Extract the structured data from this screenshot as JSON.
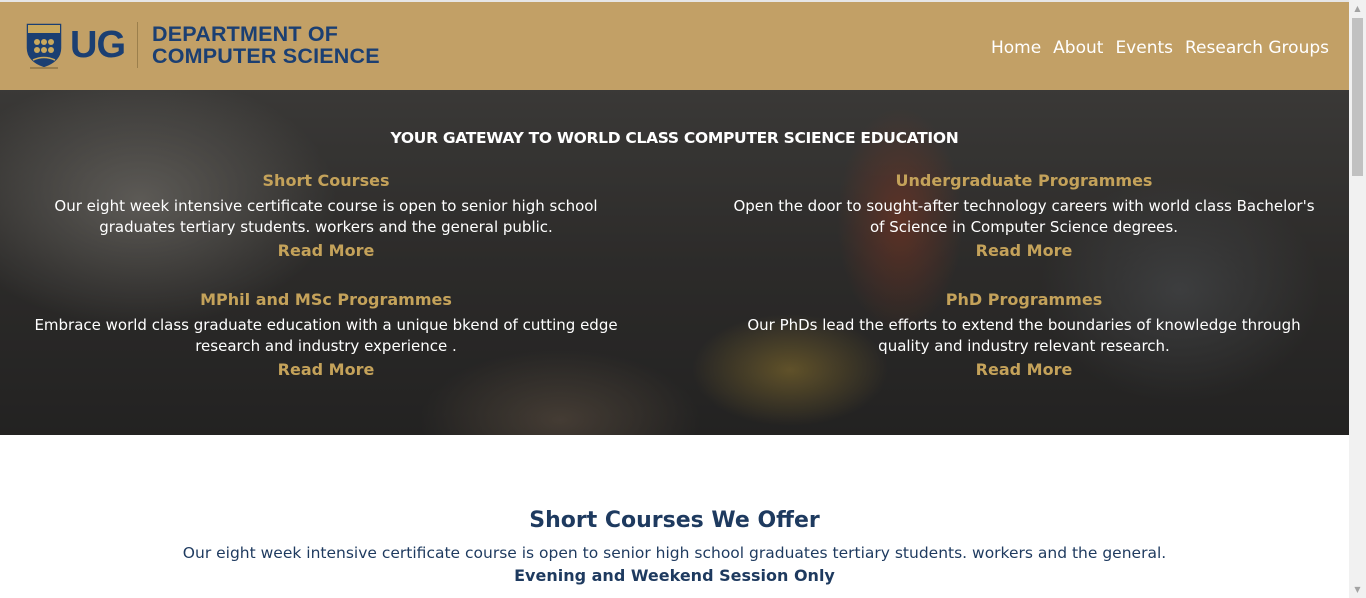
{
  "header": {
    "logo_abbrev": "UG",
    "logo_line1": "DEPARTMENT OF",
    "logo_line2": "COMPUTER SCIENCE",
    "nav": [
      "Home",
      "About",
      "Events",
      "Research Groups"
    ]
  },
  "hero": {
    "title": "YOUR GATEWAY TO WORLD CLASS COMPUTER SCIENCE EDUCATION",
    "cards": [
      {
        "title": "Short Courses",
        "body_line1": "Our eight week intensive certificate course is open to senior high school",
        "body_line2": "graduates tertiary students. workers and the general public.",
        "more": "Read More"
      },
      {
        "title": "Undergraduate Programmes",
        "body_line1": "Open the door to sought-after technology careers with world class Bachelor's",
        "body_line2": "of Science in Computer Science degrees.",
        "more": "Read More"
      },
      {
        "title": "MPhil and MSc Programmes",
        "body_line1": "Embrace world class graduate education with a unique bkend of cutting edge",
        "body_line2": "research and industry experience .",
        "more": "Read More"
      },
      {
        "title": "PhD Programmes",
        "body_line1": "Our PhDs lead the efforts to extend the boundaries of knowledge through",
        "body_line2": "quality and industry relevant research.",
        "more": "Read More"
      }
    ]
  },
  "short_courses": {
    "title": "Short Courses We Offer",
    "description": "Our eight week intensive certificate course is open to senior high school graduates tertiary students. workers and the general.",
    "note": "Evening and Weekend Session Only"
  },
  "colors": {
    "header_bg": "#c2a066",
    "brand_navy": "#1b3f72",
    "accent_gold": "#c4a25a",
    "section_text": "#1e3a5f"
  },
  "icons": {
    "crest": "university-crest-icon",
    "scroll_up": "scroll-up-arrow-icon",
    "scroll_down": "scroll-down-arrow-icon"
  }
}
